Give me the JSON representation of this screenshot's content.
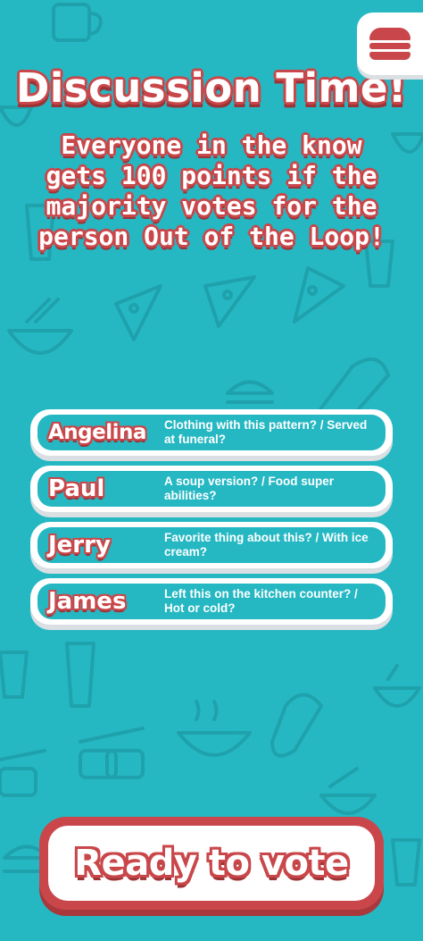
{
  "menu": {
    "icon": "burger-menu-icon"
  },
  "header": {
    "title": "Discussion Time!",
    "subtitle": "Everyone in the know gets 100 points if the majority votes for the person Out of the Loop!"
  },
  "players": [
    {
      "name": "Angelina",
      "clue": "Clothing with this pattern? / Served at funeral?"
    },
    {
      "name": "Paul",
      "clue": "A soup version? / Food super abilities?"
    },
    {
      "name": "Jerry",
      "clue": "Favorite thing about this? / With ice cream?"
    },
    {
      "name": "James",
      "clue": "Left this on the kitchen counter? / Hot or cold?"
    }
  ],
  "vote_button": {
    "label": "Ready to vote"
  },
  "colors": {
    "background": "#25b8c3",
    "accent_red": "#c9474a",
    "pattern": "#1f9ea8",
    "panel": "#ffffff"
  }
}
